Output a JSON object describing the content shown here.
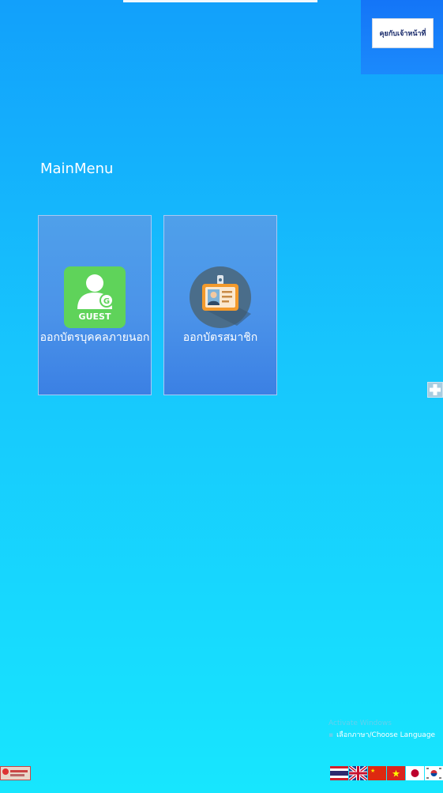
{
  "header": {
    "talk_to_staff_label": "คุยกับเจ้าหน้าที่"
  },
  "main": {
    "title": "MainMenu",
    "cards": [
      {
        "label": "ออกบัตรบุคคลภายนอก",
        "icon": "guest-icon",
        "icon_text": "GUEST",
        "badge": "G"
      },
      {
        "label": "ออกบัตรสมาชิก",
        "icon": "id-badge-icon"
      }
    ]
  },
  "language": {
    "watermark": "Activate Windows",
    "choose_label": "เลือกภาษา/Choose Language",
    "flags": [
      "thailand-flag",
      "uk-flag",
      "china-flag",
      "vietnam-flag",
      "japan-flag",
      "korea-flag"
    ]
  },
  "colors": {
    "background_top": "#12a0fb",
    "background_bottom": "#17e6fe",
    "card": "#4b93e9",
    "guest_icon": "#5fd35a"
  }
}
